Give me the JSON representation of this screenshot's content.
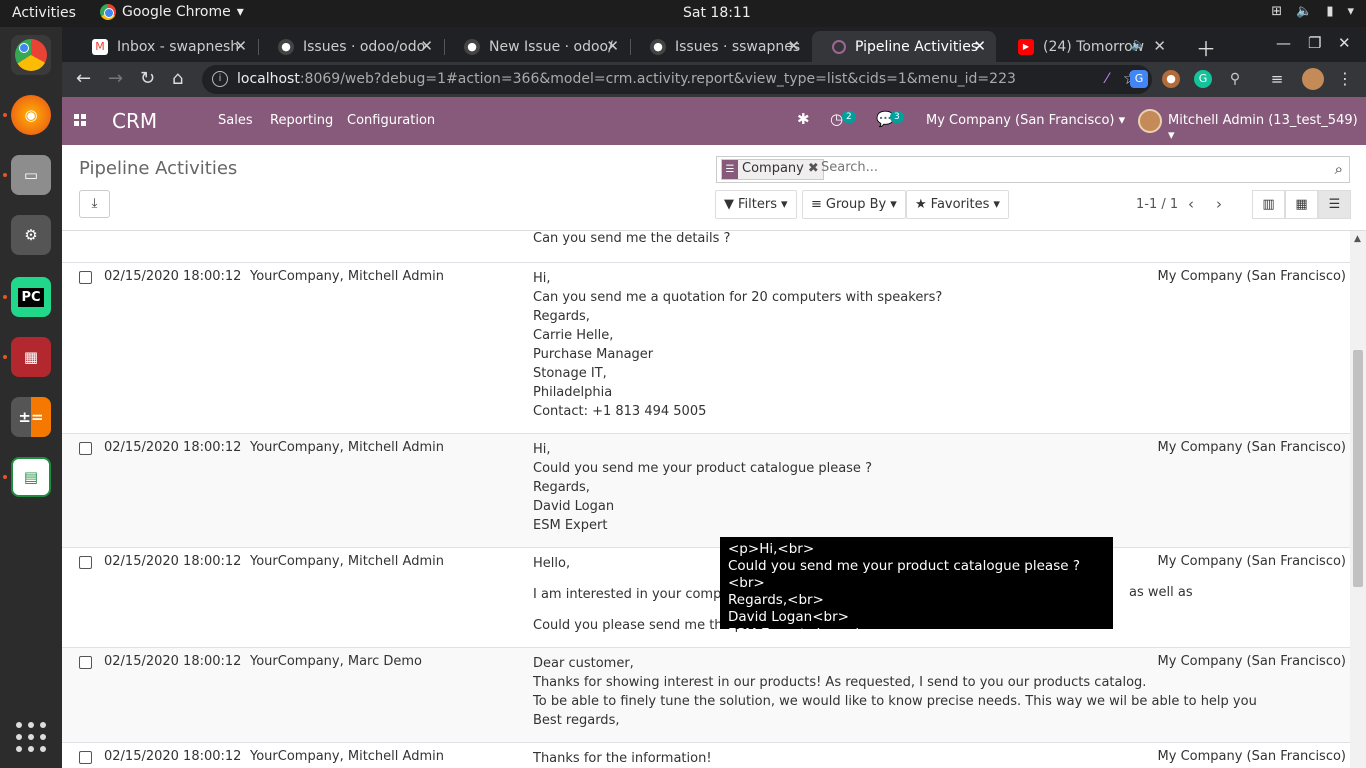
{
  "gnome": {
    "activities": "Activities",
    "app_name": "Google Chrome",
    "clock": "Sat 18:11"
  },
  "tabs": [
    {
      "title": "Inbox - swapnesh",
      "favicon": "gmail-icon"
    },
    {
      "title": "Issues · odoo/odo",
      "favicon": "github-icon"
    },
    {
      "title": "New Issue · odoo/",
      "favicon": "github-icon"
    },
    {
      "title": "Issues · sswapnes",
      "favicon": "github-icon"
    },
    {
      "title": "Pipeline Activities",
      "favicon": "odoo-icon"
    },
    {
      "title": "(24) Tomorrow",
      "favicon": "youtube-icon"
    }
  ],
  "browser": {
    "url_host": "localhost",
    "url_rest": ":8069/web?debug=1#action=366&model=crm.activity.report&view_type=list&cids=1&menu_id=223"
  },
  "odoo": {
    "brand": "CRM",
    "menu": [
      "Sales",
      "Reporting",
      "Configuration"
    ],
    "activity_count": "2",
    "message_count": "3",
    "company": "My Company (San Francisco)",
    "user": "Mitchell Admin (13_test_549)"
  },
  "control_panel": {
    "title": "Pipeline Activities",
    "facet_value": "Company",
    "search_placeholder": "Search...",
    "filters_label": "Filters",
    "groupby_label": "Group By",
    "favorites_label": "Favorites",
    "pager": "1-1 / 1"
  },
  "list": {
    "partial_line": "Can you send me the details ?",
    "rows": [
      {
        "date": "02/15/2020 18:00:12",
        "who": "YourCompany, Mitchell Admin",
        "company": "My Company (San Francisco)",
        "lines": [
          "Hi,",
          "Can you send me a quotation for 20 computers with speakers?",
          "Regards,",
          "Carrie Helle,",
          "Purchase Manager",
          "Stonage IT,",
          "Philadelphia",
          "Contact: +1 813 494 5005"
        ]
      },
      {
        "date": "02/15/2020 18:00:12",
        "who": "YourCompany, Mitchell Admin",
        "company": "My Company (San Francisco)",
        "lines": [
          "Hi,",
          "Could you send me your product catalogue please ?",
          "Regards,",
          "David Logan",
          "ESM Expert"
        ]
      },
      {
        "date": "02/15/2020 18:00:12",
        "who": "YourCompany, Mitchell Admin",
        "company": "My Company (San Francisco)",
        "line1": "Hello,",
        "line2": "I am interested in your company'",
        "line2_end": "as well as",
        "line3": "Could you please send me the p"
      },
      {
        "date": "02/15/2020 18:00:12",
        "who": "YourCompany, Marc Demo",
        "company": "My Company (San Francisco)",
        "lines": [
          "Dear customer,",
          "Thanks for showing interest in our products! As requested, I send to you our products catalog.",
          "To be able to finely tune the solution, we would like to know precise needs. This way we wil be able to help you",
          "Best regards,"
        ]
      },
      {
        "date": "02/15/2020 18:00:12",
        "who": "YourCompany, Mitchell Admin",
        "company": "My Company (San Francisco)",
        "lines": [
          "Thanks for the information!"
        ]
      }
    ]
  },
  "tooltip": {
    "lines": [
      "<p>Hi,<br>",
      "Could you send me your product catalogue please ?<br>",
      "Regards,<br>",
      "David Logan<br>",
      "ESM Expert<br></p>"
    ]
  },
  "colors": {
    "odoo_purple": "#875a7b",
    "chrome_dark": "#202124",
    "chrome_toolbar": "#35363a"
  }
}
